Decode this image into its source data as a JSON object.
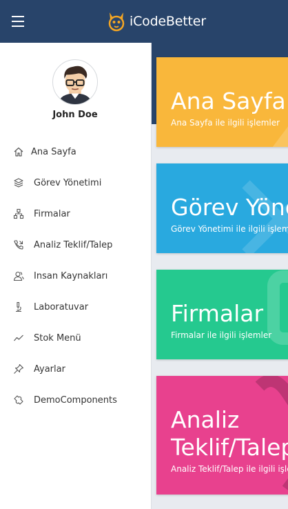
{
  "header": {
    "brand_name": "iCodeBetter",
    "menu_icon": "hamburger-icon",
    "logo_icon": "fox-mascot-logo",
    "background_color": "#28446a"
  },
  "user": {
    "name": "John Doe",
    "avatar_icon": "cartoon-avatar-icon"
  },
  "sidebar": {
    "items": [
      {
        "label": "Ana Sayfa",
        "icon": "home-icon"
      },
      {
        "label": "Görev Yönetimi",
        "icon": "layers-icon"
      },
      {
        "label": "Firmalar",
        "icon": "sitemap-icon"
      },
      {
        "label": "Analiz Teklif/Talep",
        "icon": "phone-call-icon"
      },
      {
        "label": "Insan Kaynakları",
        "icon": "users-icon"
      },
      {
        "label": "Laboratuvar",
        "icon": "microscope-icon"
      },
      {
        "label": "Stok Menü",
        "icon": "trend-line-icon"
      },
      {
        "label": "Ayarlar",
        "icon": "pushpin-icon"
      },
      {
        "label": "DemoComponents",
        "icon": "puzzle-icon"
      }
    ]
  },
  "cards": [
    {
      "title": "Ana Sayfa",
      "subtitle": "Ana Sayfa ile ilgili işlemler",
      "color": "#f9b73b"
    },
    {
      "title": "Görev Yönetimi",
      "subtitle": "Görev Yönetimi ile ilgili işlemler",
      "color": "#29a9df"
    },
    {
      "title": "Firmalar",
      "subtitle": "Firmalar ile ilgili işlemler",
      "color": "#25c98f"
    },
    {
      "title_line1": "Analiz",
      "title_line2": "Teklif/Talep",
      "subtitle": "Analiz Teklif/Talep ile ilgili işlemler",
      "color": "#e8418e"
    }
  ]
}
